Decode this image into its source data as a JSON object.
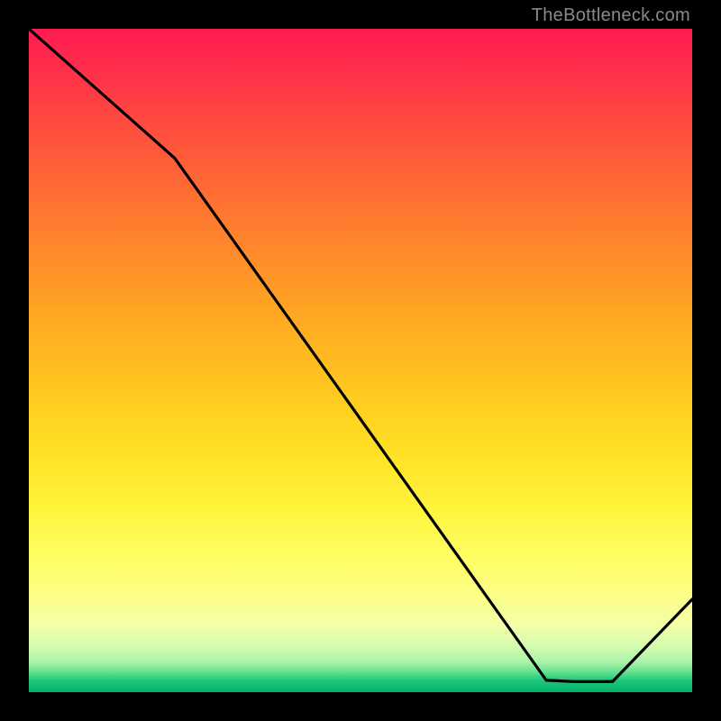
{
  "watermark": "TheBottleneck.com",
  "chart_data": {
    "type": "line",
    "title": "",
    "xlabel": "",
    "ylabel": "",
    "xlim": [
      0,
      100
    ],
    "ylim": [
      0,
      100
    ],
    "grid": false,
    "legend": false,
    "series": [
      {
        "name": "bottleneck-curve",
        "x": [
          0,
          22,
          78,
          82,
          88,
          100
        ],
        "y": [
          100,
          80.5,
          1.8,
          1.6,
          1.6,
          14
        ]
      }
    ],
    "annotations": [
      {
        "name": "flat-segment-label",
        "text": "",
        "x": 82,
        "y": 3
      }
    ],
    "background_gradient": {
      "orientation": "vertical",
      "stops": [
        {
          "pos": 0.0,
          "color": "#ff1a52"
        },
        {
          "pos": 0.5,
          "color": "#ffd023"
        },
        {
          "pos": 0.8,
          "color": "#fffe66"
        },
        {
          "pos": 0.95,
          "color": "#a9f3a8"
        },
        {
          "pos": 1.0,
          "color": "#00b46a"
        }
      ]
    }
  },
  "colors": {
    "page_bg": "#000000",
    "line": "#000000",
    "watermark": "#8a8a8a",
    "annotation": "#c22a2a"
  }
}
